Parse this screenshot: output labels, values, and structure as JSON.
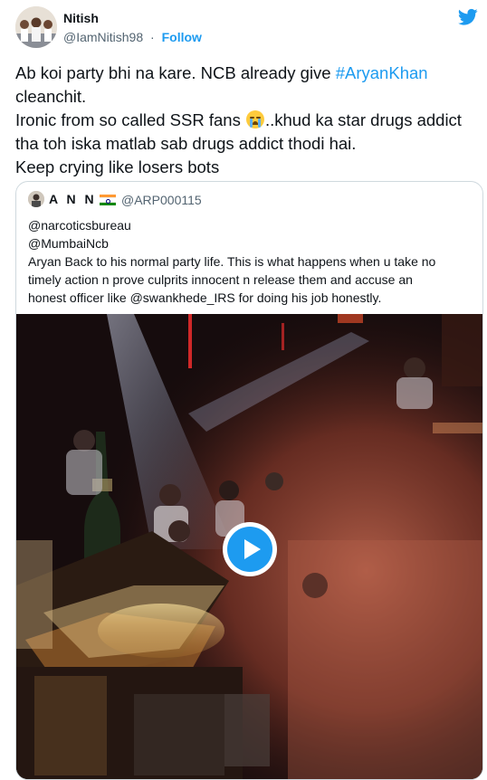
{
  "author": {
    "name": "Nitish",
    "handle": "@IamNitish98",
    "separator": "·",
    "follow_label": "Follow"
  },
  "tweet": {
    "line1_pre": "Ab koi party bhi na kare. NCB already give ",
    "line1_hashtag": "#AryanKhan",
    "line1_post": " cleanchit.",
    "line2_pre": "Ironic from so called SSR fans ",
    "line2_post": "..khud ka star drugs addict tha toh iska matlab sab drugs addict thodi hai.",
    "line3": "Keep crying like losers bots"
  },
  "quoted": {
    "name": "A N N I",
    "handle": "@ARP000115",
    "lines": [
      "@narcoticsbureau",
      "@MumbaiNcb",
      "Aryan Back to his normal party life. This is what happens when u take no",
      "timely action n prove culprits innocent n release them and accuse an",
      "honest officer like @swankhede_IRS for doing his job honestly."
    ]
  },
  "icons": {
    "twitter": "twitter-bird-icon",
    "play": "play-icon",
    "emoji": "loudly-crying-face-emoji",
    "flag": "india-flag-icon"
  },
  "colors": {
    "accent": "#1d9bf0",
    "text": "#0f1419",
    "muted": "#536471",
    "border": "#cfd9de"
  }
}
